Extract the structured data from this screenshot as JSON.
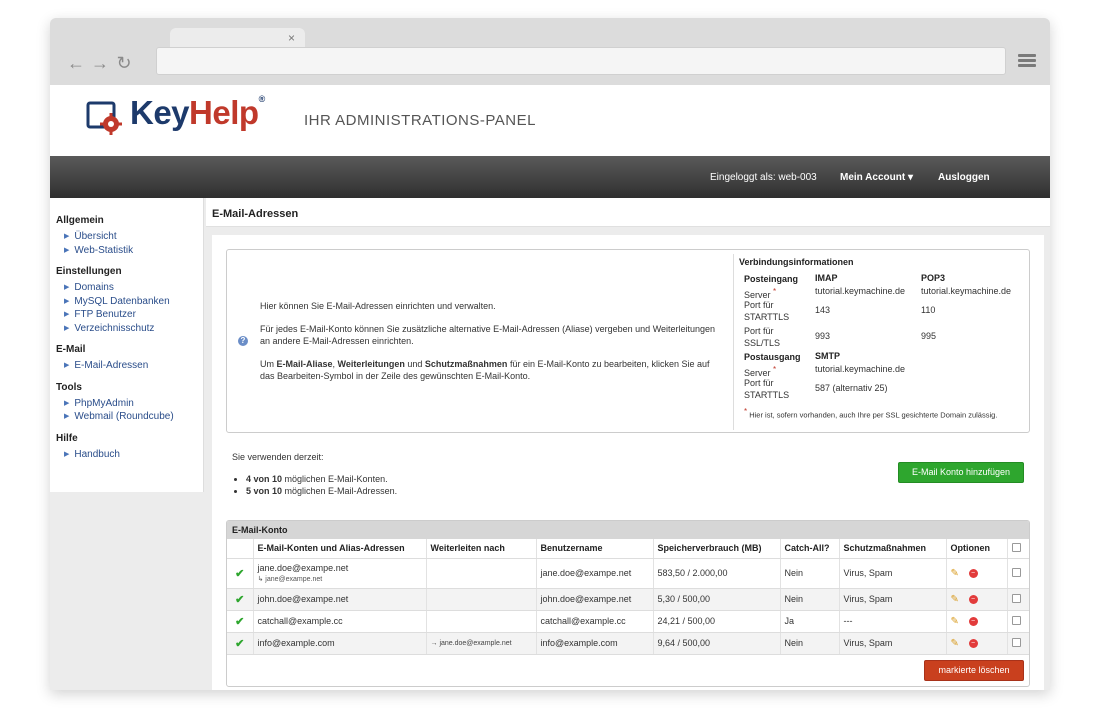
{
  "browser": {
    "tab_close": "×",
    "nav_back": "←",
    "nav_forward": "→",
    "nav_reload": "↻"
  },
  "header": {
    "logo_key": "Key",
    "logo_help": "Help",
    "logo_reg": "®",
    "tagline": "IHR ADMINISTRATIONS-PANEL"
  },
  "topbar": {
    "logged_in": "Eingeloggt als: web-003",
    "account": "Mein Account ▾",
    "logout": "Ausloggen"
  },
  "sidebar": {
    "sections": [
      {
        "title": "Allgemein",
        "items": [
          "Übersicht",
          "Web-Statistik"
        ]
      },
      {
        "title": "Einstellungen",
        "items": [
          "Domains",
          "MySQL Datenbanken",
          "FTP Benutzer",
          "Verzeichnisschutz"
        ]
      },
      {
        "title": "E-Mail",
        "items": [
          "E-Mail-Adressen"
        ]
      },
      {
        "title": "Tools",
        "items": [
          "PhpMyAdmin",
          "Webmail (Roundcube)"
        ]
      },
      {
        "title": "Hilfe",
        "items": [
          "Handbuch"
        ]
      }
    ]
  },
  "content": {
    "title": "E-Mail-Adressen",
    "info": {
      "p1": "Hier können Sie E-Mail-Adressen einrichten und verwalten.",
      "p2": "Für jedes E-Mail-Konto können Sie zusätzliche alternative E-Mail-Adressen (Aliase) vergeben und Weiterleitungen an andere E-Mail-Adressen einrichten.",
      "p3_a": "Um ",
      "p3_b1": "E-Mail-Aliase",
      "p3_c": ", ",
      "p3_b2": "Weiterleitungen",
      "p3_d": " und ",
      "p3_b3": "Schutzmaßnahmen",
      "p3_e": " für ein E-Mail-Konto zu bearbeiten, klicken Sie auf das Bearbeiten-Symbol in der Zeile des gewünschten E-Mail-Konto."
    },
    "connection": {
      "title": "Verbindungsinformationen",
      "incoming": "Posteingang",
      "imap": "IMAP",
      "pop3": "POP3",
      "server": "Server",
      "star": "*",
      "imap_server": "tutorial.keymachine.de",
      "pop3_server": "tutorial.keymachine.de",
      "port_starttls": "Port für STARTTLS",
      "imap_starttls": "143",
      "pop3_starttls": "110",
      "port_ssl": "Port für SSL/TLS",
      "imap_ssl": "993",
      "pop3_ssl": "995",
      "outgoing": "Postausgang",
      "smtp": "SMTP",
      "smtp_server": "tutorial.keymachine.de",
      "smtp_starttls": "587 (alternativ 25)",
      "note": "Hier ist, sofern vorhanden, auch Ihre per SSL gesichterte Domain zulässig."
    },
    "usage": {
      "intro": "Sie verwenden derzeit:",
      "accounts_bold": "4 von 10",
      "accounts_rest": " möglichen E-Mail-Konten.",
      "addresses_bold": "5 von 10",
      "addresses_rest": " möglichen E-Mail-Adressen."
    },
    "add_button": "E-Mail Konto hinzufügen",
    "table": {
      "title": "E-Mail-Konto",
      "columns": [
        "E-Mail-Konten und Alias-Adressen",
        "Weiterleiten nach",
        "Benutzername",
        "Speicherverbrauch (MB)",
        "Catch-All?",
        "Schutzmaßnahmen",
        "Optionen"
      ],
      "rows": [
        {
          "status": "✔",
          "email": "jane.doe@exampe.net",
          "alias": "↳ jane@exampe.net",
          "forward": "",
          "username": "jane.doe@exampe.net",
          "storage": "583,50 / 2.000,00",
          "catchall": "Nein",
          "protection": "Virus, Spam"
        },
        {
          "status": "✔",
          "email": "john.doe@exampe.net",
          "alias": "",
          "forward": "",
          "username": "john.doe@exampe.net",
          "storage": "5,30 / 500,00",
          "catchall": "Nein",
          "protection": "Virus, Spam"
        },
        {
          "status": "✔",
          "email": "catchall@example.cc",
          "alias": "",
          "forward": "",
          "username": "catchall@example.cc",
          "storage": "24,21 / 500,00",
          "catchall": "Ja",
          "protection": "---"
        },
        {
          "status": "✔",
          "email": "info@example.com",
          "alias": "",
          "forward": "→ jane.doe@example.net",
          "username": "info@example.com",
          "storage": "9,64 / 500,00",
          "catchall": "Nein",
          "protection": "Virus, Spam"
        }
      ],
      "edit_icon": "✎",
      "delete_icon": "−"
    },
    "delete_button": "markierte löschen"
  }
}
